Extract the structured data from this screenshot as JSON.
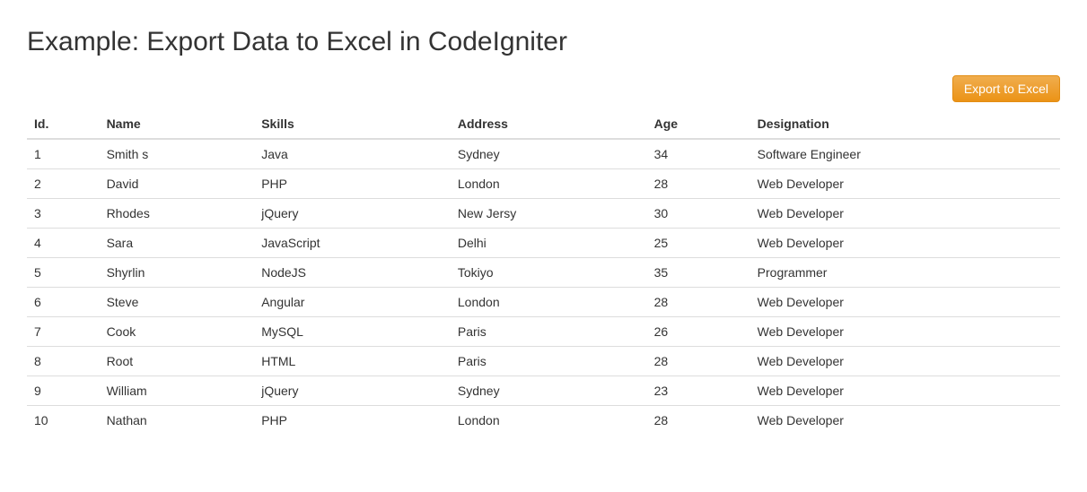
{
  "title": "Example: Export Data to Excel in CodeIgniter",
  "toolbar": {
    "export_label": "Export to Excel"
  },
  "table": {
    "headers": {
      "id": "Id.",
      "name": "Name",
      "skills": "Skills",
      "address": "Address",
      "age": "Age",
      "designation": "Designation"
    },
    "rows": [
      {
        "id": "1",
        "name": "Smith s",
        "skills": "Java",
        "address": "Sydney",
        "age": "34",
        "designation": "Software Engineer"
      },
      {
        "id": "2",
        "name": "David",
        "skills": "PHP",
        "address": "London",
        "age": "28",
        "designation": "Web Developer"
      },
      {
        "id": "3",
        "name": "Rhodes",
        "skills": "jQuery",
        "address": "New Jersy",
        "age": "30",
        "designation": "Web Developer"
      },
      {
        "id": "4",
        "name": "Sara",
        "skills": "JavaScript",
        "address": "Delhi",
        "age": "25",
        "designation": "Web Developer"
      },
      {
        "id": "5",
        "name": "Shyrlin",
        "skills": "NodeJS",
        "address": "Tokiyo",
        "age": "35",
        "designation": "Programmer"
      },
      {
        "id": "6",
        "name": "Steve",
        "skills": "Angular",
        "address": "London",
        "age": "28",
        "designation": "Web Developer"
      },
      {
        "id": "7",
        "name": "Cook",
        "skills": "MySQL",
        "address": "Paris",
        "age": "26",
        "designation": "Web Developer"
      },
      {
        "id": "8",
        "name": "Root",
        "skills": "HTML",
        "address": "Paris",
        "age": "28",
        "designation": "Web Developer"
      },
      {
        "id": "9",
        "name": "William",
        "skills": "jQuery",
        "address": "Sydney",
        "age": "23",
        "designation": "Web Developer"
      },
      {
        "id": "10",
        "name": "Nathan",
        "skills": "PHP",
        "address": "London",
        "age": "28",
        "designation": "Web Developer"
      }
    ]
  }
}
